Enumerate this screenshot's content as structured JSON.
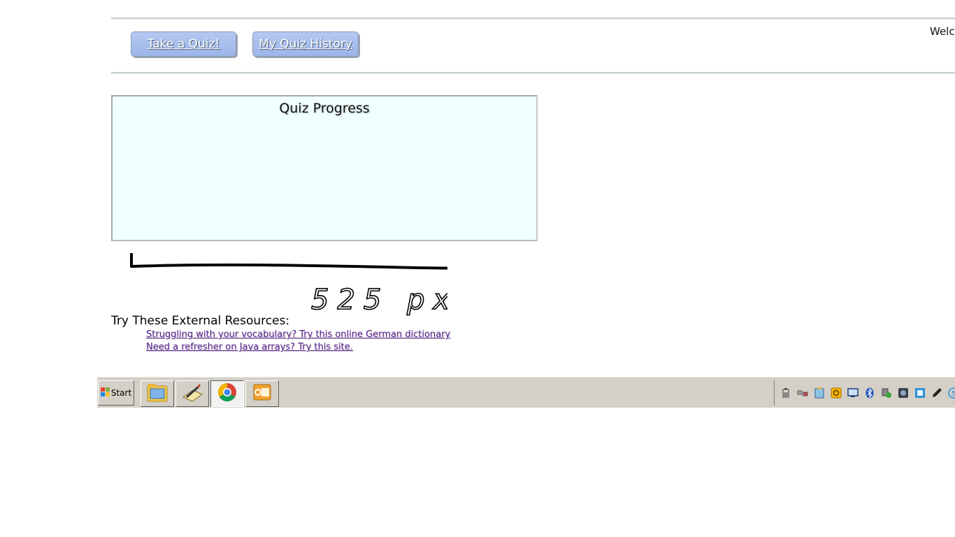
{
  "header": {
    "buttons": {
      "take_quiz": "Take a Quiz!",
      "quiz_history": "My Quiz History"
    },
    "welcome_text": "Welco"
  },
  "progress": {
    "title": "Quiz Progress"
  },
  "annotation": {
    "measure_text": "525 px"
  },
  "resources": {
    "heading": "Try These External Resources:",
    "links": [
      "Struggling with your vocabulary? Try this online German dictionary",
      "Need a refresher on Java arrays? Try this site."
    ]
  },
  "taskbar": {
    "start_label": "Start",
    "apps": [
      "file-explorer-icon",
      "pencil-notepad-icon",
      "chrome-icon",
      "outlook-icon"
    ],
    "tray_icons": [
      "battery-icon",
      "network-icon",
      "clipboard-icon",
      "office-icon",
      "display-icon",
      "bluetooth-icon",
      "security-shield-icon",
      "camera-icon",
      "app-icon",
      "pen-icon",
      "volume-icon"
    ]
  },
  "colors": {
    "button_bg": "#9db6ea",
    "progress_bg": "#f0ffff",
    "link": "#551a8b",
    "taskbar_bg": "#d4d0c8"
  }
}
